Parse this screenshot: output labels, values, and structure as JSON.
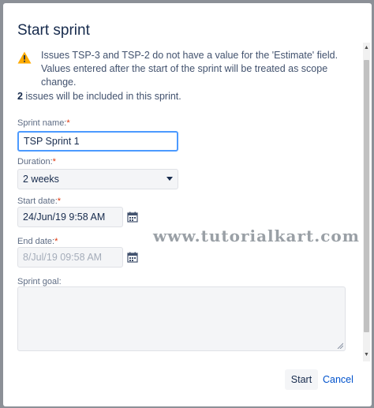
{
  "dialog": {
    "title": "Start sprint",
    "warning": "Issues TSP-3 and TSP-2 do not have a value for the 'Estimate' field. Values entered after the start of the sprint will be treated as scope change.",
    "issues_count": "2",
    "issues_text": " issues will be included in this sprint."
  },
  "form": {
    "sprint_name_label": "Sprint name:",
    "sprint_name_value": "TSP Sprint 1",
    "duration_label": "Duration:",
    "duration_value": "2 weeks",
    "start_date_label": "Start date:",
    "start_date_value": "24/Jun/19 9:58 AM",
    "end_date_label": "End date:",
    "end_date_value": "8/Jul/19 09:58 AM",
    "sprint_goal_label": "Sprint goal:",
    "required_marker": "*"
  },
  "footer": {
    "start_label": "Start",
    "cancel_label": "Cancel"
  },
  "watermark": "www.tutorialkart.com",
  "colors": {
    "accent": "#0052cc",
    "focus": "#4c9aff",
    "warning": "#ffab00",
    "required": "#de350b"
  }
}
